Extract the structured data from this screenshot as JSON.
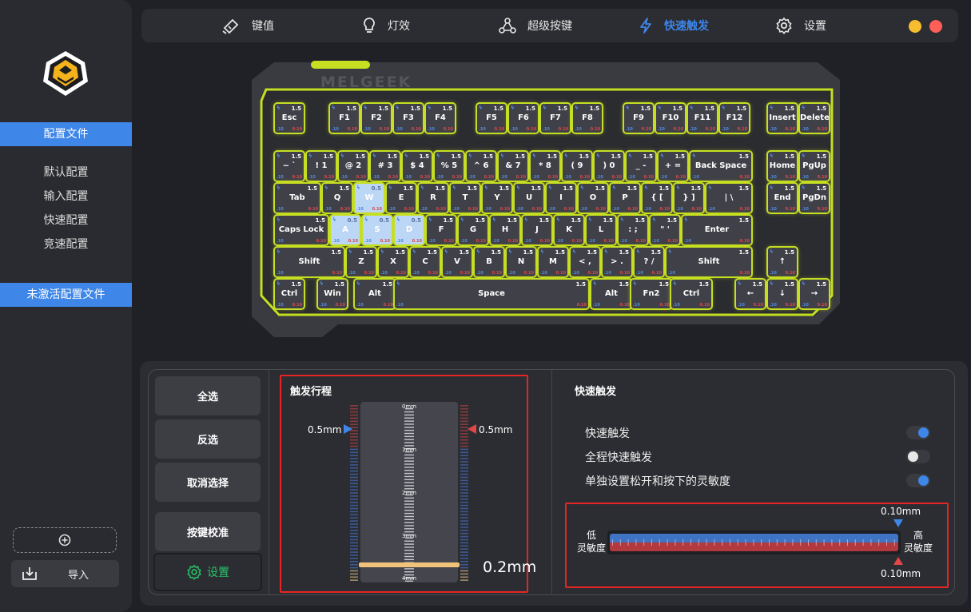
{
  "sidebar": {
    "profiles_header": "配置文件",
    "profiles": [
      "默认配置",
      "输入配置",
      "快速配置",
      "竞速配置"
    ],
    "inactive_header": "未激活配置文件",
    "add_icon": "plus-circle-icon",
    "import_label": "导入"
  },
  "nav": {
    "tabs": [
      {
        "label": "键值",
        "icon": "keycap-icon"
      },
      {
        "label": "灯效",
        "icon": "lightbulb-icon"
      },
      {
        "label": "超级按键",
        "icon": "nodes-icon"
      },
      {
        "label": "快速触发",
        "icon": "lightning-icon",
        "active": true
      },
      {
        "label": "设置",
        "icon": "gear-icon"
      }
    ]
  },
  "keyboard": {
    "brand": "MELGEEK",
    "default_value": "1.5",
    "bottom_left": ".10",
    "bottom_right": "0.10",
    "selected_value": "0.5",
    "accent_color": "#c6df22",
    "rows": [
      [
        "Esc",
        "F1",
        "F2",
        "F3",
        "F4",
        "F5",
        "F6",
        "F7",
        "F8",
        "F9",
        "F10",
        "F11",
        "F12",
        "Insert",
        "Delete"
      ],
      [
        "~ `",
        "! 1",
        "@ 2",
        "# 3",
        "$ 4",
        "% 5",
        "^ 6",
        "& 7",
        "* 8",
        "( 9",
        ") 0",
        "_ -",
        "+ =",
        "Back Space",
        "Home",
        "PgUp"
      ],
      [
        "Tab",
        "Q",
        "W",
        "E",
        "R",
        "T",
        "Y",
        "U",
        "I",
        "O",
        "P",
        "{ [",
        "} ]",
        "| \\",
        "End",
        "PgDn"
      ],
      [
        "Caps Lock",
        "A",
        "S",
        "D",
        "F",
        "G",
        "H",
        "J",
        "K",
        "L",
        ": ;",
        "\" '",
        "Enter"
      ],
      [
        "Shift",
        "Z",
        "X",
        "C",
        "V",
        "B",
        "N",
        "M",
        "< ,",
        "> .",
        "? /",
        "Shift",
        "↑"
      ],
      [
        "Ctrl",
        "Win",
        "Alt",
        "Space",
        "Alt",
        "Fn2",
        "Ctrl",
        "←",
        "↓",
        "→"
      ]
    ],
    "selected_keys": [
      "W",
      "A",
      "S",
      "D"
    ]
  },
  "actions": {
    "select_all": "全选",
    "invert": "反选",
    "cancel": "取消选择",
    "calibrate": "按键校准",
    "settings": "设置"
  },
  "travel": {
    "title": "触发行程",
    "scale": [
      "0mm",
      "1mm",
      "2mm",
      "3mm",
      "4mm"
    ],
    "left_value": "0.5mm",
    "right_value": "0.5mm",
    "current": "0.2mm",
    "level_fraction": 0.95
  },
  "rapid": {
    "title": "快速触发",
    "options": [
      {
        "label": "快速触发",
        "on": true
      },
      {
        "label": "全程快速触发",
        "on": false
      },
      {
        "label": "单独设置松开和按下的灵敏度",
        "on": true
      }
    ],
    "sensitivity": {
      "low": "低\n灵敏度",
      "high": "高\n灵敏度",
      "top_value": "0.10mm",
      "bottom_value": "0.10mm",
      "press_color": "#3e86e8",
      "release_color": "#d9534f"
    }
  },
  "window": {
    "minimize_color": "#f5bd2f",
    "close_color": "#ff5f57"
  }
}
